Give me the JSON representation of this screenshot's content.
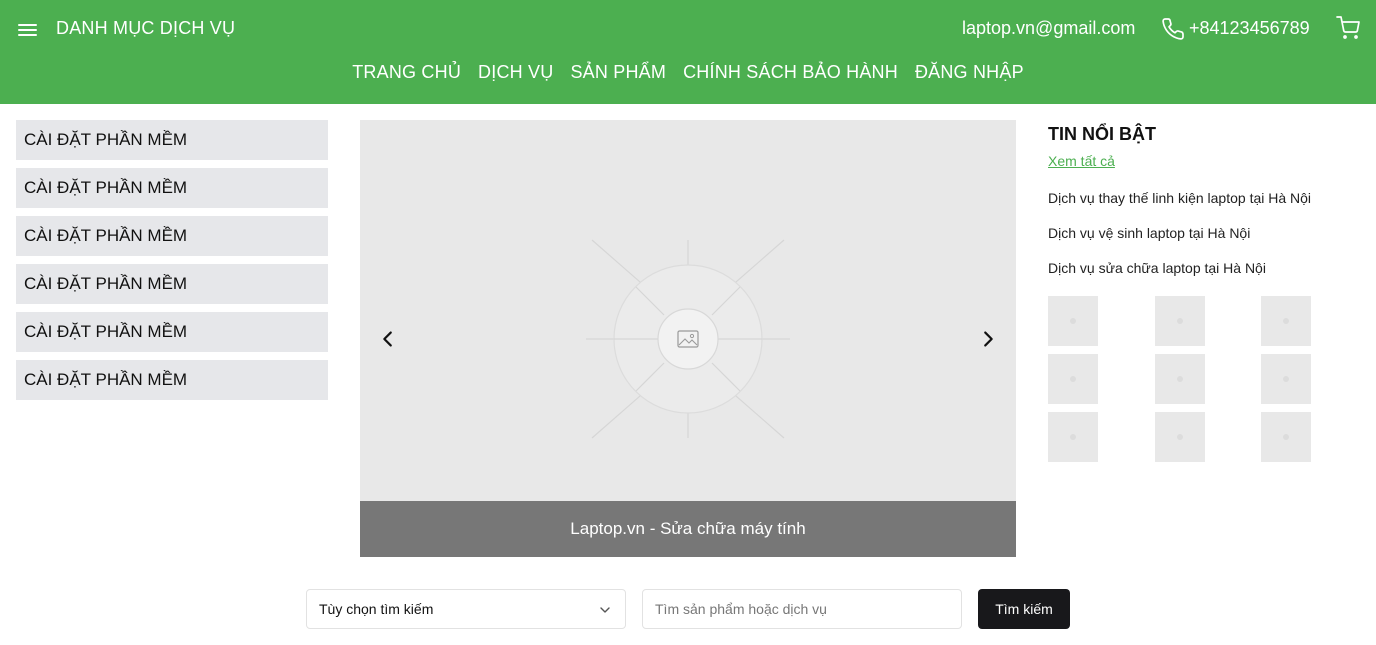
{
  "header": {
    "category_title": "DANH MỤC DỊCH VỤ",
    "email": "laptop.vn@gmail.com",
    "phone": "+84123456789",
    "icons": {
      "menu": "hamburger-menu-icon",
      "phone": "phone-icon",
      "cart": "shopping-cart-icon"
    },
    "bg_color": "#4caf50"
  },
  "nav": {
    "items": [
      {
        "label": "TRANG CHỦ"
      },
      {
        "label": "DỊCH VỤ"
      },
      {
        "label": "SẢN PHẨM"
      },
      {
        "label": "CHÍNH SÁCH BẢO HÀNH"
      },
      {
        "label": "ĐĂNG NHẬP"
      }
    ]
  },
  "sidebar": {
    "items": [
      {
        "label": "CÀI ĐẶT PHẦN MỀM"
      },
      {
        "label": "CÀI ĐẶT PHẦN MỀM"
      },
      {
        "label": "CÀI ĐẶT PHẦN MỀM"
      },
      {
        "label": "CÀI ĐẶT PHẦN MỀM"
      },
      {
        "label": "CÀI ĐẶT PHẦN MỀM"
      },
      {
        "label": "CÀI ĐẶT PHẦN MỀM"
      }
    ]
  },
  "carousel": {
    "caption": "Laptop.vn - Sửa chữa máy tính",
    "icons": {
      "prev": "chevron-left-icon",
      "next": "chevron-right-icon",
      "image": "image-placeholder-icon"
    }
  },
  "news": {
    "title": "TIN NỔI BẬT",
    "view_all": "Xem tất cả",
    "items": [
      {
        "title": "Dịch vụ thay thế linh kiện laptop tại Hà Nội"
      },
      {
        "title": "Dịch vụ vệ sinh laptop tại Hà Nội"
      },
      {
        "title": "Dịch vụ sửa chữa laptop tại Hà Nội"
      }
    ],
    "thumbnail_count": 9
  },
  "search": {
    "select_label": "Tùy chọn tìm kiếm",
    "input_placeholder": "Tìm sản phẩm hoặc dịch vụ",
    "input_value": "",
    "button_label": "Tìm kiếm"
  }
}
